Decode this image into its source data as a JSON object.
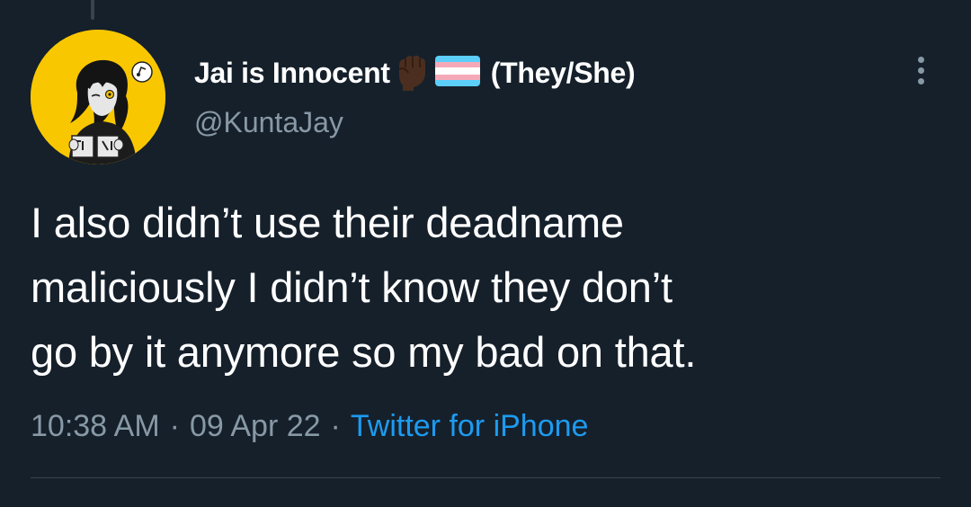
{
  "tweet": {
    "author": {
      "display_name": "Jai is Innocent",
      "pronouns": "(They/She)",
      "handle": "@KuntaJay",
      "emoji": [
        "raised-fist-dark-skin-icon",
        "transgender-flag-icon"
      ]
    },
    "text": "I also didn’t use their deadname\nmaliciously I didn’t know they don’t\ngo by it anymore so my bad on that.",
    "time": "10:38 AM",
    "separator": "·",
    "date": "09 Apr 22",
    "source": "Twitter for iPhone"
  },
  "colors": {
    "background": "#15202b",
    "primary_text": "#ffffff",
    "secondary_text": "#8899a6",
    "link": "#1d9bf0",
    "avatar_bg": "#f9c700"
  },
  "icons": {
    "more": "more-options-icon"
  }
}
